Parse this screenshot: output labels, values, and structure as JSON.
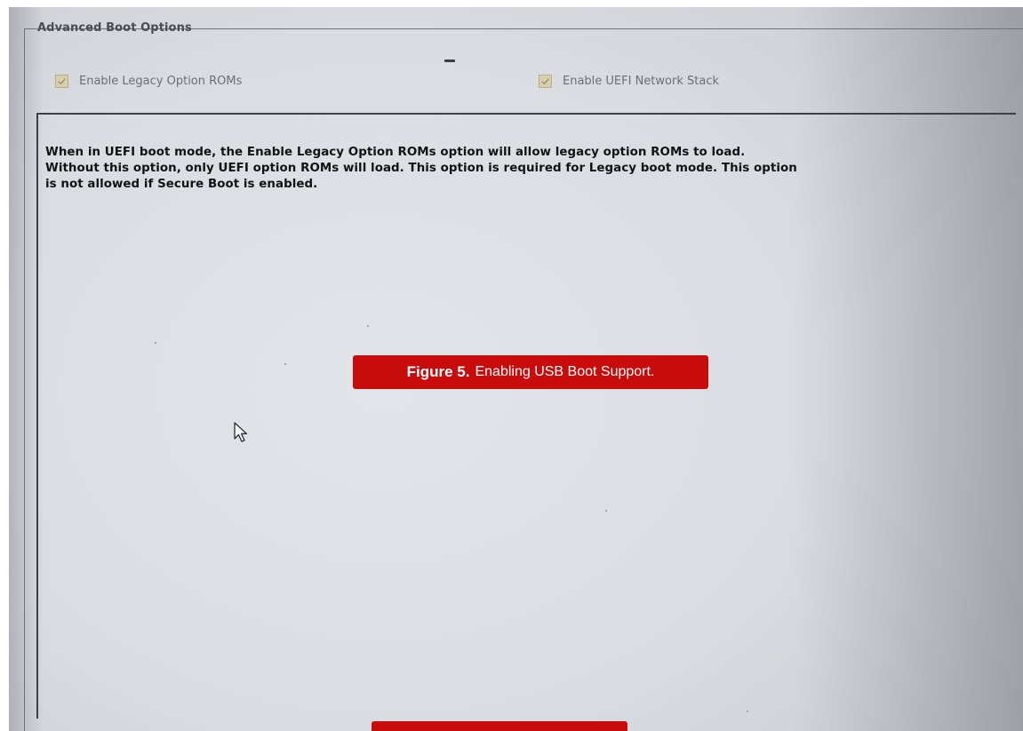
{
  "group": {
    "title": "Advanced Boot Options"
  },
  "options": [
    {
      "label": "Enable Legacy Option ROMs",
      "checked": true,
      "enabled": false
    },
    {
      "label": "Enable UEFI Network Stack",
      "checked": true,
      "enabled": false
    }
  ],
  "description": {
    "lines": [
      "When in UEFI boot mode, the Enable Legacy Option ROMs option will allow legacy option ROMs to load.",
      "Without this option, only UEFI option ROMs will load. This option is required for Legacy boot mode. This option",
      "is not allowed if Secure Boot is enabled."
    ]
  },
  "caption": {
    "label": "Figure 5.",
    "text": "Enabling USB Boot Support."
  },
  "icons": {
    "checkbox_check": "check-icon",
    "cursor": "mouse-pointer-icon"
  },
  "colors": {
    "caption_bg": "#c80b0b",
    "checkbox_fill": "#d8cfab",
    "screen_bg": "#dde1e5"
  }
}
